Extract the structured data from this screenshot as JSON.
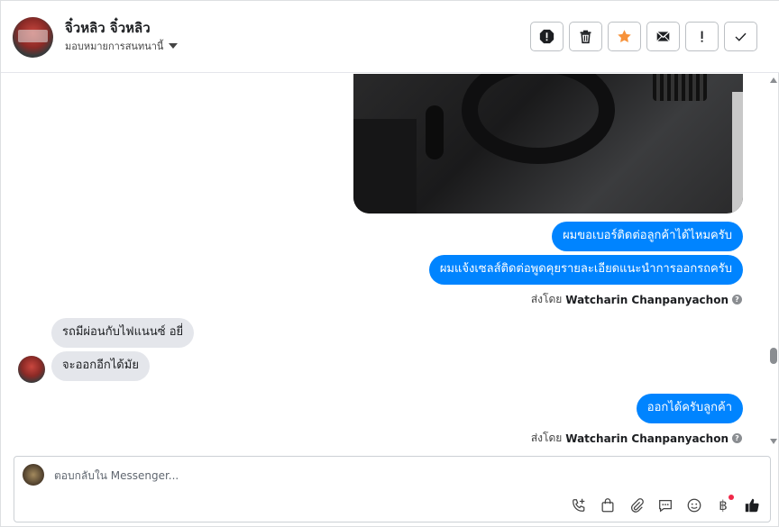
{
  "header": {
    "contact_name": "จิ๋วหลิว จิ๋วหลิว",
    "assign_label": "มอบหมายการสนทนานี้",
    "actions": [
      {
        "name": "report-spam-icon"
      },
      {
        "name": "trash-icon"
      },
      {
        "name": "star-icon",
        "color": "#f7923a"
      },
      {
        "name": "envelope-icon"
      },
      {
        "name": "exclamation-icon"
      },
      {
        "name": "check-icon"
      }
    ]
  },
  "messages": {
    "out1": "ผมขอเบอร์ติดต่อลูกค้าได้ไหมครับ",
    "out2": "ผมแจ้งเซลส์ติดต่อพูดคุยรายละเอียดแนะนำการออกรถครับ",
    "sent_by_1": {
      "prefix": "ส่งโดย",
      "name": "Watcharin Chanpanyachon"
    },
    "in1": "รถมีผ่อนกับไฟแนนซ์ อยี่",
    "in2": "จะออกอีกได้มัย",
    "out3": "ออกได้ครับลูกค้า",
    "sent_by_2": {
      "prefix": "ส่งโดย",
      "name": "Watcharin Chanpanyachon"
    }
  },
  "composer": {
    "placeholder": "ตอบกลับใน Messenger...",
    "tools": [
      "phone-plus-icon",
      "shopping-bag-icon",
      "paperclip-icon",
      "comment-icon",
      "smiley-icon",
      "baht-icon",
      "thumbs-up-icon"
    ]
  },
  "colors": {
    "outgoing_bubble": "#0084ff",
    "incoming_bubble": "#e4e6eb",
    "star": "#f7923a"
  }
}
